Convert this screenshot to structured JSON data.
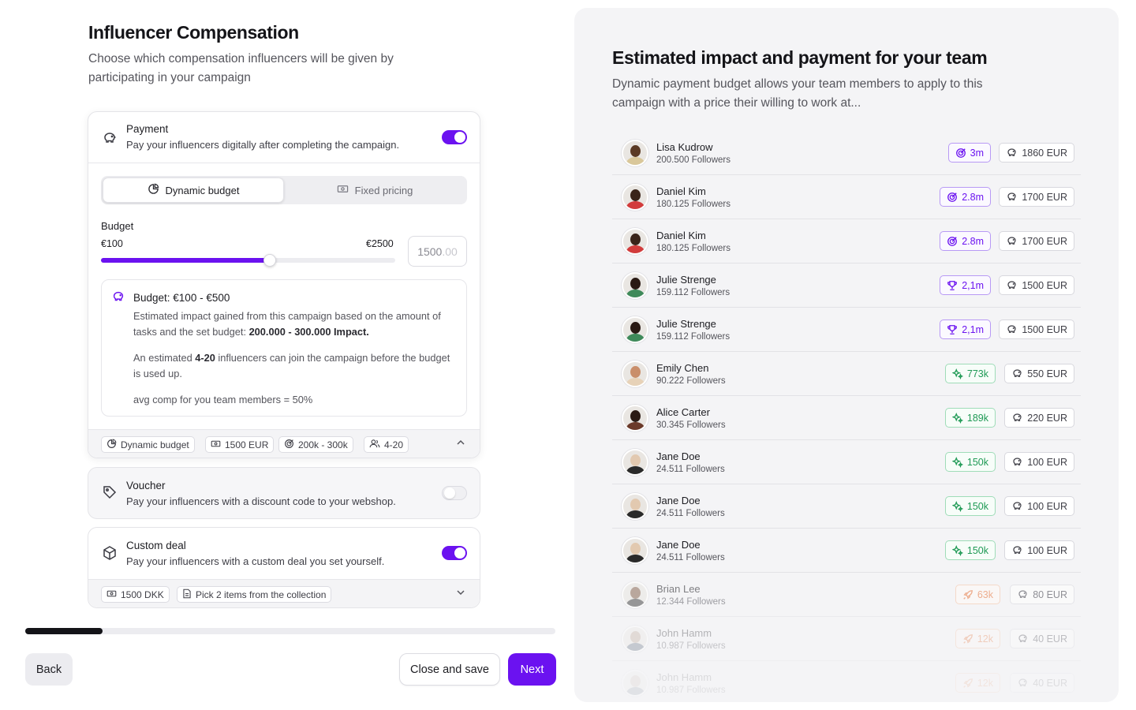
{
  "left": {
    "title": "Influencer Compensation",
    "subtitle": "Choose which compensation influencers will be given by participating in your campaign",
    "payment": {
      "title": "Payment",
      "desc": "Pay your influencers digitally after completing the campaign.",
      "enabled": true,
      "tabs": [
        "Dynamic budget",
        "Fixed pricing"
      ],
      "budget_label": "Budget",
      "range_min": "€100",
      "range_max": "€2500",
      "slider_fraction": 0.575,
      "input_value": "1500",
      "input_decimals": ".00",
      "info": {
        "title": "Budget: €100 - €500",
        "p1_text": "Estimated impact gained from this campaign based on the amount of tasks and the set budget: ",
        "p1_bold": "200.000 - 300.000 Impact.",
        "p2_pre": "An estimated ",
        "p2_bold": "4-20",
        "p2_post": " influencers can join the campaign before the budget is used up.",
        "p3": "avg comp for you team members = 50%"
      },
      "chips": [
        "Dynamic budget",
        "1500 EUR",
        "200k - 300k",
        "4-20"
      ]
    },
    "voucher": {
      "title": "Voucher",
      "desc": "Pay your influencers with a discount code to your webshop.",
      "enabled": false
    },
    "custom_deal": {
      "title": "Custom deal",
      "desc": "Pay your influencers with a custom deal you set yourself.",
      "enabled": true,
      "chips": [
        "1500 DKK",
        "Pick 2 items from the collection"
      ]
    },
    "progress_fraction": 0.146,
    "buttons": {
      "back": "Back",
      "close": "Close and save",
      "next": "Next"
    }
  },
  "right": {
    "title": "Estimated impact and payment for your team",
    "subtitle": "Dynamic payment budget allows your team members to apply to this campaign with a price their willing to work at...",
    "members": [
      {
        "name": "Lisa Kudrow",
        "followers": "200.500 Followers",
        "impact": "3m",
        "tier": "purple",
        "tier_icon": "target-icon",
        "payment": "1860 EUR",
        "skin": "#5b3a24",
        "shirt": "#d9c79a"
      },
      {
        "name": "Daniel Kim",
        "followers": "180.125 Followers",
        "impact": "2.8m",
        "tier": "purple",
        "tier_icon": "target-icon",
        "payment": "1700 EUR",
        "skin": "#3a241a",
        "shirt": "#d23c3c"
      },
      {
        "name": "Daniel Kim",
        "followers": "180.125 Followers",
        "impact": "2.8m",
        "tier": "purple",
        "tier_icon": "target-icon",
        "payment": "1700 EUR",
        "skin": "#3a241a",
        "shirt": "#d23c3c"
      },
      {
        "name": "Julie Strenge",
        "followers": "159.112 Followers",
        "impact": "2,1m",
        "tier": "purple",
        "tier_icon": "trophy-icon",
        "payment": "1500 EUR",
        "skin": "#2a1a14",
        "shirt": "#3f8a5a"
      },
      {
        "name": "Julie Strenge",
        "followers": "159.112 Followers",
        "impact": "2,1m",
        "tier": "purple",
        "tier_icon": "trophy-icon",
        "payment": "1500 EUR",
        "skin": "#2a1a14",
        "shirt": "#3f8a5a"
      },
      {
        "name": "Emily Chen",
        "followers": "90.222 Followers",
        "impact": "773k",
        "tier": "green",
        "tier_icon": "sparkle-icon",
        "payment": "550 EUR",
        "skin": "#c98e6a",
        "shirt": "#e7d2b8"
      },
      {
        "name": "Alice Carter",
        "followers": "30.345 Followers",
        "impact": "189k",
        "tier": "green",
        "tier_icon": "sparkle-icon",
        "payment": "220 EUR",
        "skin": "#2b1b15",
        "shirt": "#6b3a2a"
      },
      {
        "name": "Jane Doe",
        "followers": "24.511 Followers",
        "impact": "150k",
        "tier": "green",
        "tier_icon": "sparkle-icon",
        "payment": "100 EUR",
        "skin": "#e2c9b0",
        "shirt": "#2a2a2a"
      },
      {
        "name": "Jane Doe",
        "followers": "24.511 Followers",
        "impact": "150k",
        "tier": "green",
        "tier_icon": "sparkle-icon",
        "payment": "100 EUR",
        "skin": "#e2c9b0",
        "shirt": "#2a2a2a"
      },
      {
        "name": "Jane Doe",
        "followers": "24.511 Followers",
        "impact": "150k",
        "tier": "green",
        "tier_icon": "sparkle-icon",
        "payment": "100 EUR",
        "skin": "#e2c9b0",
        "shirt": "#2a2a2a"
      },
      {
        "name": "Brian Lee",
        "followers": "12.344 Followers",
        "impact": "63k",
        "tier": "orange",
        "tier_icon": "rocket-icon",
        "payment": "80 EUR",
        "skin": "#8a6a55",
        "shirt": "#4a4a4a"
      },
      {
        "name": "John Hamm",
        "followers": "10.987 Followers",
        "impact": "12k",
        "tier": "orange",
        "tier_icon": "rocket-icon",
        "payment": "40 EUR",
        "skin": "#b8a090",
        "shirt": "#5a6a7a"
      },
      {
        "name": "John Hamm",
        "followers": "10.987 Followers",
        "impact": "12k",
        "tier": "orange",
        "tier_icon": "rocket-icon",
        "payment": "40 EUR",
        "skin": "#b8a090",
        "shirt": "#5a6a7a"
      }
    ]
  },
  "colors": {
    "accent": "#6b12f0",
    "purple_badge": "#6b12f0",
    "green_badge": "#1f9a55",
    "orange_badge": "#e8743a"
  }
}
